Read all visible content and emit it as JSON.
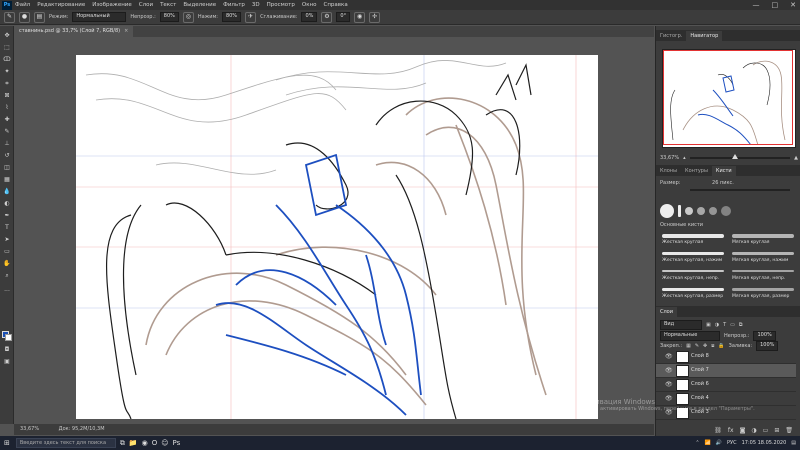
{
  "menubar": {
    "logo": "Ps",
    "items": [
      "Файл",
      "Редактирование",
      "Изображение",
      "Слои",
      "Текст",
      "Выделение",
      "Фильтр",
      "3D",
      "Просмотр",
      "Окно",
      "Справка"
    ],
    "win_min": "—",
    "win_max": "□",
    "win_close": "✕"
  },
  "options": {
    "mode_label": "Режим:",
    "mode_value": "Нормальный",
    "opacity_label": "Непрозр.:",
    "opacity_value": "80%",
    "flow_label": "Нажим:",
    "flow_value": "80%",
    "smooth_label": "Сглаживание:",
    "smooth_value": "0%",
    "angle_value": "0°"
  },
  "document": {
    "tab_title": "ставнинь.psd @ 33,7% (Слой 7, RGB/8)",
    "close": "×"
  },
  "status": {
    "zoom": "33,67%",
    "doc_size": "Док: 95,2M/10,3M"
  },
  "panels": {
    "navigator_tabs": [
      "Гистогр.",
      "Навигатор"
    ],
    "zoom_value": "33,67%",
    "zoom_fraction": 0.45,
    "brush_tabs": [
      "Клоны",
      "Контуры",
      "Кисти"
    ],
    "size_label": "Размер:",
    "size_value": "26 пикс.",
    "brush_folder": "Основные кисти",
    "brushes": [
      [
        "Жесткая круглая",
        "Мягкая круглая"
      ],
      [
        "Жесткая круглая, нажим",
        "Мягкая круглая, нажим"
      ],
      [
        "Жесткая круглая, непр.",
        "Мягкая круглая, непр."
      ],
      [
        "Жесткая круглая, размер",
        "Мягкая круглая, размер"
      ]
    ],
    "layers_tabs": [
      "Слои"
    ],
    "kind_label": "Вид",
    "blend_value": "Нормальные",
    "opacity_label": "Непрозр.:",
    "opacity_value": "100%",
    "lock_label": "Закреп.:",
    "fill_label": "Заливка:",
    "fill_value": "100%",
    "layers": [
      {
        "name": "Слой 8",
        "active": false
      },
      {
        "name": "Слой 7",
        "active": true
      },
      {
        "name": "Слой 6",
        "active": false
      },
      {
        "name": "Слой 4",
        "active": false
      },
      {
        "name": "Слой 3",
        "active": false
      }
    ]
  },
  "watermark": {
    "line1": "Активация Windows",
    "line2": "Чтобы активировать Windows, перейдите в раздел \"Параметры\"."
  },
  "taskbar": {
    "search_placeholder": "Введите здесь текст для поиска",
    "tray_lang": "РУС",
    "time": "17:05",
    "date": "18.05.2020"
  },
  "colors": {
    "foreground": "#1a4fb5",
    "background": "#ffffff",
    "accent": "#e33333"
  }
}
